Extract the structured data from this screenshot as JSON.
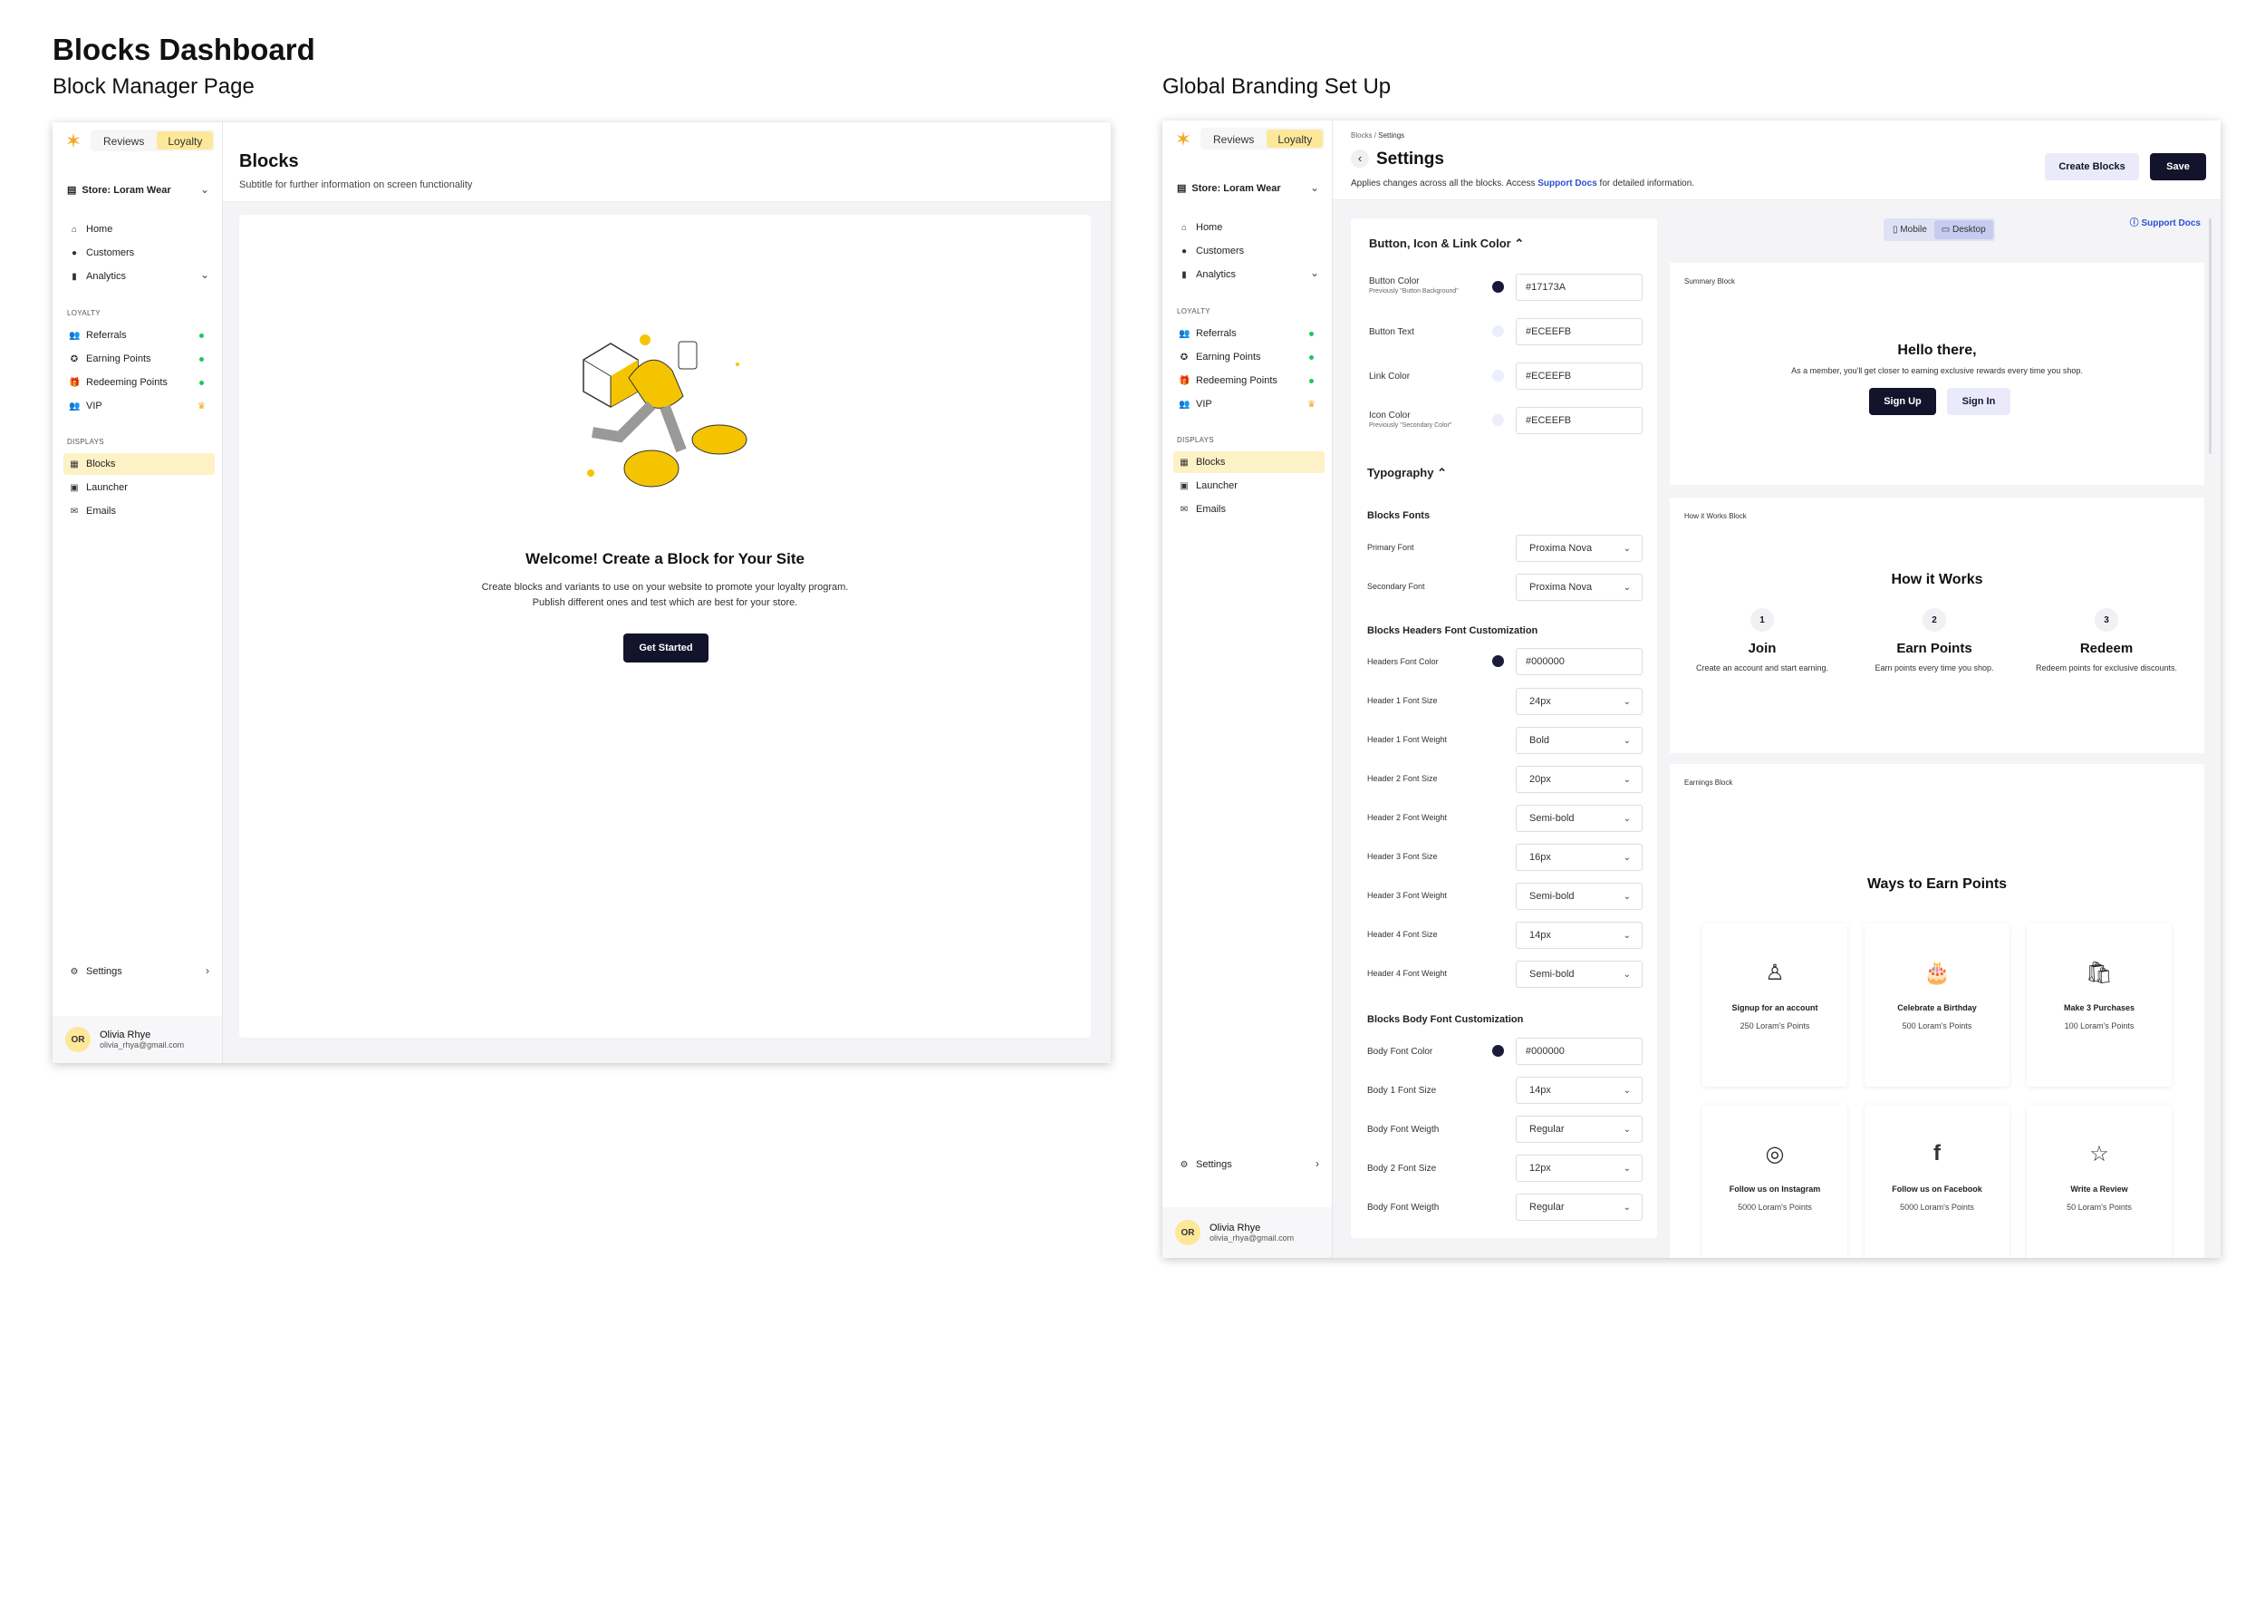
{
  "page": {
    "title": "Blocks Dashboard",
    "left_title": "Block Manager Page",
    "right_title": "Global Branding Set Up"
  },
  "tabs": {
    "reviews": "Reviews",
    "loyalty": "Loyalty"
  },
  "store": {
    "label": "Store: Loram Wear"
  },
  "nav": {
    "home": "Home",
    "customers": "Customers",
    "analytics": "Analytics",
    "loyalty_section": "LOYALTY",
    "referrals": "Referrals",
    "earning_points": "Earning Points",
    "redeeming_points": "Redeeming Points",
    "vip": "VIP",
    "displays_section": "DISPLAYS",
    "blocks": "Blocks",
    "launcher": "Launcher",
    "emails": "Emails",
    "settings": "Settings"
  },
  "user": {
    "initials": "OR",
    "name": "Olivia Rhye",
    "email": "olivia_rhya@gmail.com"
  },
  "blocks_page": {
    "title": "Blocks",
    "subtitle": "Subtitle for further information on screen functionality",
    "empty_title": "Welcome! Create a Block for Your Site",
    "empty_line1": "Create blocks and variants to use on your website to promote your loyalty program.",
    "empty_line2": "Publish different ones and test which are best for your store.",
    "cta": "Get Started"
  },
  "settings_page": {
    "breadcrumb_root": "Blocks",
    "breadcrumb_sep": " / ",
    "breadcrumb_current": "Settings",
    "title": "Settings",
    "desc_before": "Applies changes across all the blocks. Access ",
    "desc_link": "Support Docs",
    "desc_after": " for detailed information.",
    "create_btn": "Create Blocks",
    "save_btn": "Save",
    "support_docs": "Support Docs",
    "view_mobile": "Mobile",
    "view_desktop": "Desktop"
  },
  "color_section": {
    "heading": "Button, Icon & Link Color",
    "button_color": {
      "label": "Button Color",
      "sub": "Previously \"Button Background\"",
      "value": "#17173A",
      "swatch": "#17173A"
    },
    "button_text": {
      "label": "Button Text",
      "value": "#ECEEFB",
      "swatch": "#ECEEFB"
    },
    "link_color": {
      "label": "Link Color",
      "value": "#ECEEFB",
      "swatch": "#ECEEFB"
    },
    "icon_color": {
      "label": "Icon Color",
      "sub": "Previously \"Secondary Color\"",
      "value": "#ECEEFB",
      "swatch": "#ECEEFB"
    }
  },
  "typography": {
    "heading": "Typography",
    "fonts_group": "Blocks Fonts",
    "primary_font": {
      "label": "Primary Font",
      "value": "Proxima Nova"
    },
    "secondary_font": {
      "label": "Secondary Font",
      "value": "Proxima Nova"
    },
    "headers_group": "Blocks Headers Font Customization",
    "headers_color": {
      "label": "Headers  Font Color",
      "value": "#000000",
      "swatch": "#1a1a3a"
    },
    "h1_size": {
      "label": "Header 1 Font Size",
      "value": "24px"
    },
    "h1_weight": {
      "label": "Header 1 Font  Weight",
      "value": "Bold"
    },
    "h2_size": {
      "label": "Header 2 Font Size",
      "value": "20px"
    },
    "h2_weight": {
      "label": "Header 2 Font  Weight",
      "value": "Semi-bold"
    },
    "h3_size": {
      "label": "Header 3 Font Size",
      "value": "16px"
    },
    "h3_weight": {
      "label": "Header 3 Font  Weight",
      "value": "Semi-bold"
    },
    "h4_size": {
      "label": "Header 4 Font Size",
      "value": "14px"
    },
    "h4_weight": {
      "label": "Header 4 Font  Weight",
      "value": "Semi-bold"
    },
    "body_group": "Blocks Body Font Customization",
    "body_color": {
      "label": "Body Font Color",
      "value": "#000000",
      "swatch": "#1a1a3a"
    },
    "b1_size": {
      "label": "Body 1 Font Size",
      "value": "14px"
    },
    "b1_weight": {
      "label": "Body Font Weigth",
      "value": "Regular"
    },
    "b2_size": {
      "label": "Body 2 Font Size",
      "value": "12px"
    },
    "b2_weight": {
      "label": "Body Font Weigth",
      "value": "Regular"
    }
  },
  "preview": {
    "summary": {
      "tag": "Summary Block",
      "title": "Hello there,",
      "text": "As a member, you'll get closer to earning exclusive rewards every time you shop.",
      "sign_up": "Sign Up",
      "sign_in": "Sign In"
    },
    "how": {
      "tag": "How it Works Block",
      "title": "How it Works",
      "steps": [
        {
          "num": "1",
          "title": "Join",
          "desc": "Create an account and start earning."
        },
        {
          "num": "2",
          "title": "Earn Points",
          "desc": "Earn points every time you shop."
        },
        {
          "num": "3",
          "title": "Redeem",
          "desc": "Redeem points for exclusive discounts."
        }
      ]
    },
    "earn": {
      "tag": "Earnings Block",
      "title": "Ways to Earn Points",
      "tiles": [
        {
          "icon": "user-icon",
          "glyph": "♙",
          "title": "Signup for an account",
          "points": "250 Loram's Points"
        },
        {
          "icon": "cake-icon",
          "glyph": "🎂",
          "title": "Celebrate a Birthday",
          "points": "500 Loram's Points"
        },
        {
          "icon": "shopping-bag-icon",
          "glyph": "🛍",
          "title": "Make 3 Purchases",
          "points": "100 Loram's Points"
        },
        {
          "icon": "instagram-icon",
          "glyph": "◎",
          "title": "Follow us on Instagram",
          "points": "5000 Loram's Points"
        },
        {
          "icon": "facebook-icon",
          "glyph": "f",
          "title": "Follow us on Facebook",
          "points": "5000 Loram's Points"
        },
        {
          "icon": "star-icon",
          "glyph": "☆",
          "title": "Write a Review",
          "points": "50 Loram's Points"
        }
      ]
    }
  },
  "colors": {
    "accent_yellow": "#FDE89A",
    "dark": "#13132B",
    "link": "#2B50D6",
    "status_green": "#22C55E"
  }
}
